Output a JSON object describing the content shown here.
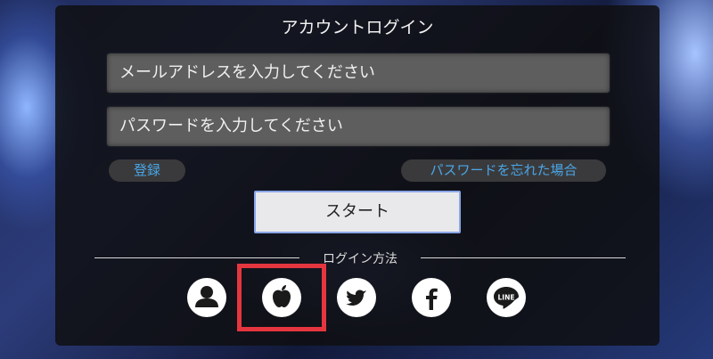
{
  "login": {
    "title": "アカウントログイン",
    "email_placeholder": "メールアドレスを入力してください",
    "password_placeholder": "パスワードを入力してください",
    "register_label": "登録",
    "forgot_label": "パスワードを忘れた場合",
    "start_label": "スタート",
    "method_label": "ログイン方法"
  },
  "methods": [
    {
      "icon": "user-icon"
    },
    {
      "icon": "apple-icon"
    },
    {
      "icon": "twitter-icon"
    },
    {
      "icon": "facebook-icon"
    },
    {
      "icon": "line-icon"
    }
  ],
  "colors": {
    "panel": "#0f0f12",
    "field": "#5e5e5e",
    "link": "#4aa6e6",
    "start_border": "#8aa6e8",
    "highlight": "#e5363f"
  }
}
